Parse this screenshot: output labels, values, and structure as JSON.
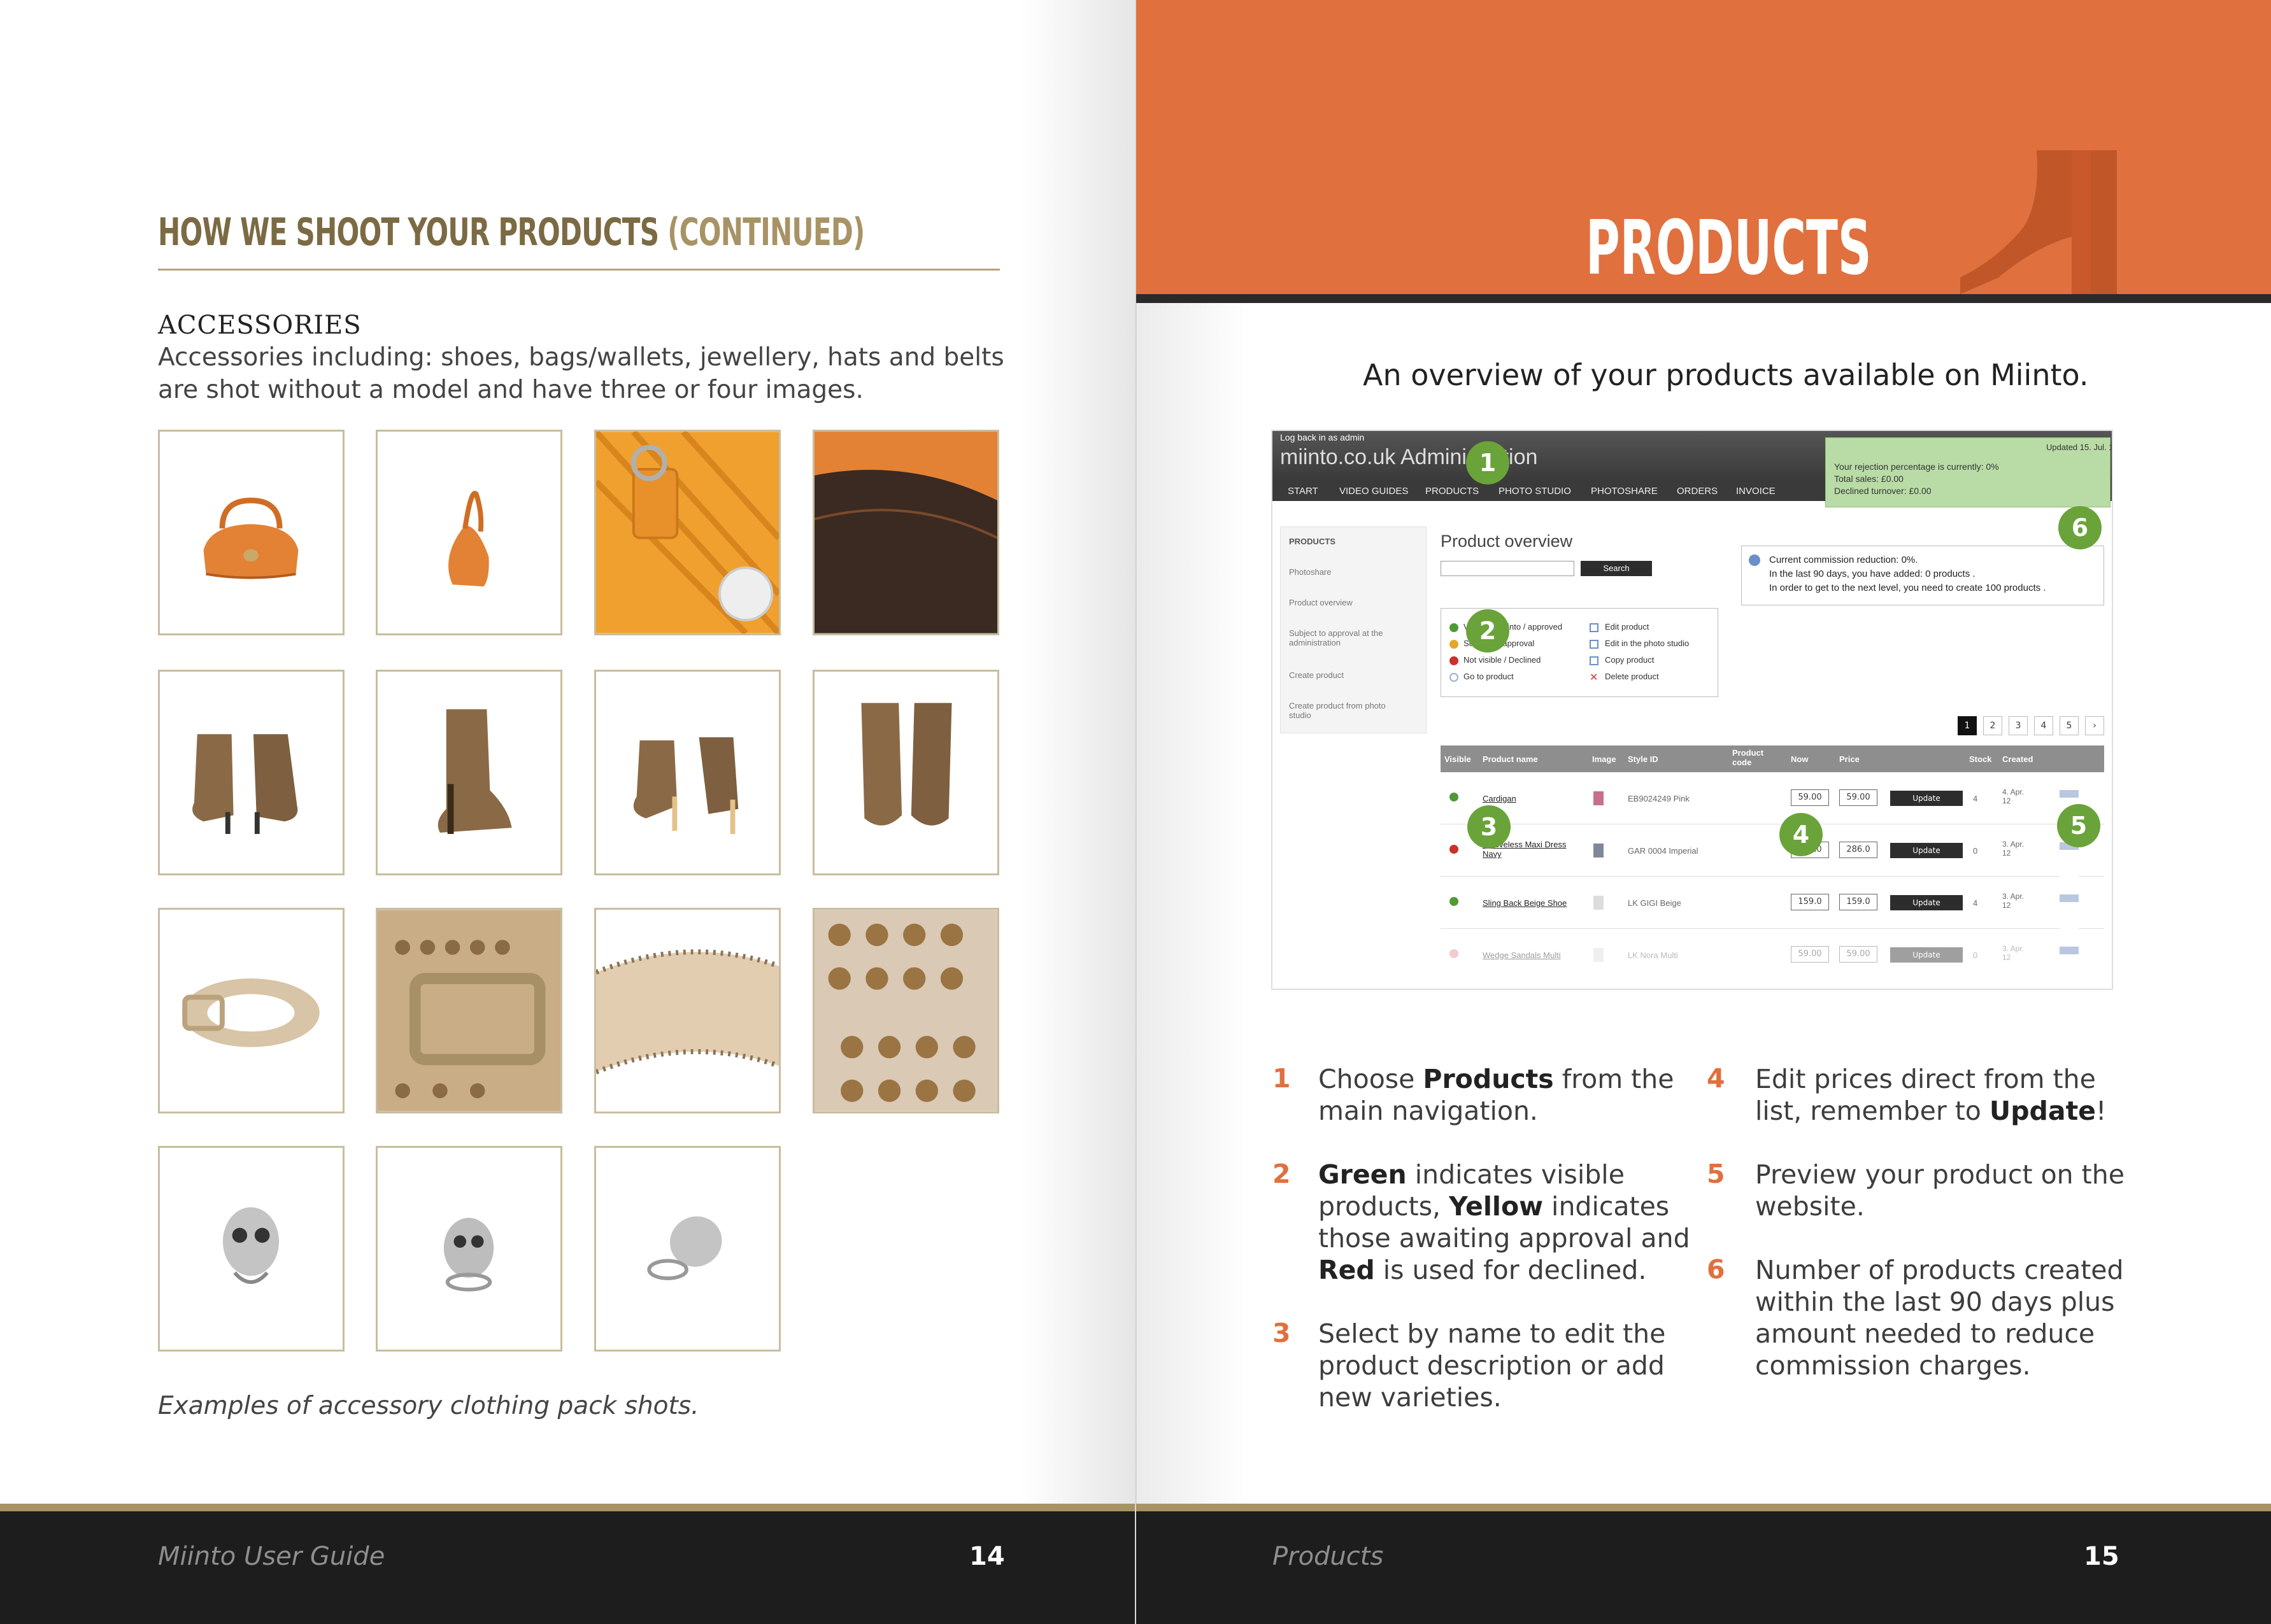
{
  "left_page": {
    "title": "HOW WE SHOOT YOUR PRODUCTS",
    "title_suffix": "(CONTINUED)",
    "section_heading": "ACCESSORIES",
    "section_text": "Accessories including: shoes, bags/wallets, jewellery, hats and belts are shot without a model and have three or four images.",
    "caption": "Examples of accessory clothing pack shots.",
    "footer_label": "Miinto User Guide",
    "page_number": "14"
  },
  "right_page": {
    "title": "PRODUCTS",
    "intro": "An overview of your products available on Miinto.",
    "footer_label": "Products",
    "page_number": "15",
    "accent_color": "#e0703e",
    "badge_color": "#6aa339"
  },
  "admin": {
    "login_text": "Log back in as admin",
    "brand": "miinto.co.uk Administration",
    "nav": [
      "START",
      "VIDEO GUIDES",
      "PRODUCTS",
      "PHOTO STUDIO",
      "PHOTOSHARE",
      "ORDERS",
      "INVOICE"
    ],
    "notice": {
      "updated": "Updated 15. Jul. 12",
      "line1": "Your rejection percentage is currently: 0%",
      "line2": "Total sales: £0.00",
      "line3": "Declined turnover: £0.00"
    },
    "sidebar": [
      "PRODUCTS",
      "Photoshare",
      "Product overview",
      "Subject to approval at the administration",
      "Create product",
      "Create product from photo studio"
    ],
    "heading": "Product overview",
    "search_button": "Search",
    "commission": {
      "line1": "Current commission reduction: 0%.",
      "line2": "In the last 90 days, you have added: 0 products .",
      "line3": "In order to get to the next level, you need to create 100 products ."
    },
    "legend_left": [
      "Visible in Miinto / approved",
      "Subject to approval",
      "Not visible / Declined",
      "Go to product"
    ],
    "legend_right": [
      "Edit product",
      "Edit in the photo studio",
      "Copy product",
      "Delete product"
    ],
    "pagination": [
      "1",
      "2",
      "3",
      "4",
      "5",
      "›"
    ],
    "columns": [
      "Visible",
      "Product name",
      "Image",
      "Style ID",
      "Product code",
      "Now",
      "Price",
      "Stock",
      "Created"
    ],
    "rows": [
      {
        "status": "#4f9a36",
        "name": "Cardigan",
        "style": "EB9024249 Pink",
        "now": "59.00",
        "price": "59.00",
        "stock": "4",
        "created": "4. Apr. 12"
      },
      {
        "status": "#c8322b",
        "name": "Sleeveless Maxi Dress Navy",
        "style": "GAR 0004 Imperial",
        "now": "286.0",
        "price": "286.0",
        "stock": "0",
        "created": "3. Apr. 12"
      },
      {
        "status": "#4f9a36",
        "name": "Sling Back Beige Shoe",
        "style": "LK GIGI Beige",
        "now": "159.0",
        "price": "159.0",
        "stock": "4",
        "created": "3. Apr. 12"
      },
      {
        "status": "#e58b8b",
        "name": "Wedge Sandals Multi",
        "style": "LK Nora Multi",
        "now": "59.00",
        "price": "59.00",
        "stock": "0",
        "created": "3. Apr. 12"
      }
    ],
    "update_label": "Update",
    "badges": [
      "1",
      "2",
      "3",
      "4",
      "5",
      "6"
    ]
  },
  "steps": [
    {
      "num": "1",
      "pre": "Choose ",
      "bold": "Products",
      "post": " from the main navigation."
    },
    {
      "num": "2",
      "html_parts": [
        "Green",
        " indicates visible products, ",
        "Yellow",
        " indicates those awaiting approval and ",
        "Red",
        " is used for declined."
      ]
    },
    {
      "num": "3",
      "text": "Select by name to edit the product description or add new varieties."
    },
    {
      "num": "4",
      "pre": "Edit prices direct from the list, remember to ",
      "bold": "Update",
      "post": "!"
    },
    {
      "num": "5",
      "text": "Preview your product on the website."
    },
    {
      "num": "6",
      "text": "Number of products created within the last 90 days plus amount needed to reduce commission charges."
    }
  ],
  "thumbnails": [
    "orange-bag-front",
    "orange-bag-side",
    "orange-bag-detail",
    "orange-bag-inside",
    "leopard-boots-front",
    "leopard-boot-side",
    "leopard-boots-back",
    "leopard-boots-top",
    "studded-belt-coil",
    "studded-belt-buckle",
    "belt-underside",
    "belt-studs-closeup",
    "skull-ring-front",
    "skull-ring-angle",
    "skull-ring-side"
  ]
}
